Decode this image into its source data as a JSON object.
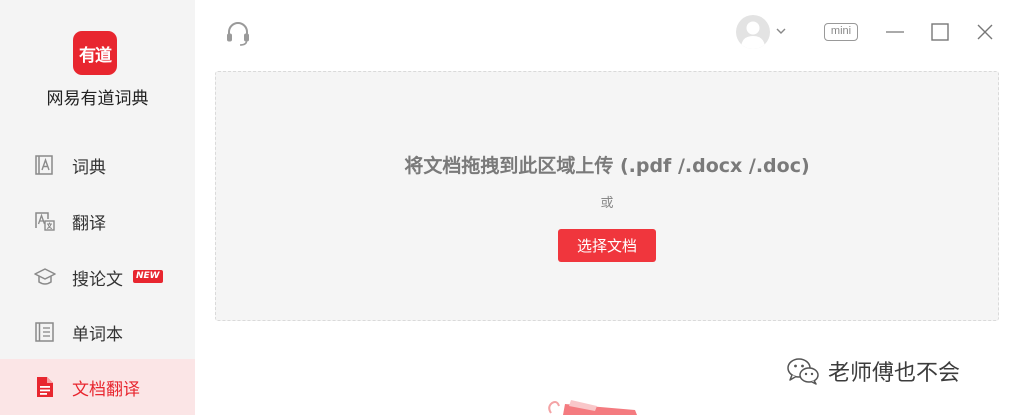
{
  "app": {
    "logo_text": "有道",
    "name": "网易有道词典"
  },
  "sidebar": {
    "items": [
      {
        "label": "词典",
        "icon": "dictionary-icon",
        "active": false
      },
      {
        "label": "翻译",
        "icon": "translate-icon",
        "active": false
      },
      {
        "label": "搜论文",
        "icon": "graduation-cap-icon",
        "active": false,
        "badge": "NEW"
      },
      {
        "label": "单词本",
        "icon": "wordbook-icon",
        "active": false
      },
      {
        "label": "文档翻译",
        "icon": "document-icon",
        "active": true
      }
    ]
  },
  "topbar": {
    "mini_label": "mini"
  },
  "dropzone": {
    "title": "将文档拖拽到此区域上传 (.pdf /.docx /.doc)",
    "or_text": "或",
    "button_label": "选择文档"
  },
  "watermark": {
    "text": "老师傅也不会"
  },
  "colors": {
    "brand_red": "#e8262f",
    "button_red": "#f0363d",
    "sidebar_bg": "#f4f4f4",
    "active_bg": "#fbe5e6",
    "dropzone_bg": "#f5f5f5"
  }
}
